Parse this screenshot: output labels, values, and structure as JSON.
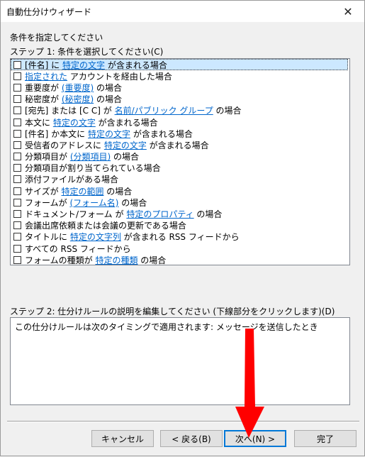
{
  "window": {
    "title": "自動仕分けウィザード",
    "close_icon": "✕"
  },
  "labels": {
    "instruction": "条件を指定してください",
    "step1": "ステップ 1: 条件を選択してください(C)",
    "step2": "ステップ 2: 仕分けルールの説明を編集してください (下線部分をクリックします)(D)"
  },
  "conditions": [
    {
      "parts": [
        {
          "t": "[件名] に "
        },
        {
          "t": "特定の文字",
          "link": true
        },
        {
          "t": " が含まれる場合"
        }
      ]
    },
    {
      "parts": [
        {
          "t": "指定された",
          "link": true
        },
        {
          "t": " アカウントを経由した場合"
        }
      ]
    },
    {
      "parts": [
        {
          "t": "重要度が "
        },
        {
          "t": "(重要度)",
          "link": true
        },
        {
          "t": " の場合"
        }
      ]
    },
    {
      "parts": [
        {
          "t": "秘密度が "
        },
        {
          "t": "(秘密度)",
          "link": true
        },
        {
          "t": " の場合"
        }
      ]
    },
    {
      "parts": [
        {
          "t": "[宛先] または [C C] が "
        },
        {
          "t": "名前/パブリック グループ",
          "link": true
        },
        {
          "t": " の場合"
        }
      ]
    },
    {
      "parts": [
        {
          "t": "本文に "
        },
        {
          "t": "特定の文字",
          "link": true
        },
        {
          "t": " が含まれる場合"
        }
      ]
    },
    {
      "parts": [
        {
          "t": "[件名] か本文に "
        },
        {
          "t": "特定の文字",
          "link": true
        },
        {
          "t": " が含まれる場合"
        }
      ]
    },
    {
      "parts": [
        {
          "t": "受信者のアドレスに "
        },
        {
          "t": "特定の文字",
          "link": true
        },
        {
          "t": " が含まれる場合"
        }
      ]
    },
    {
      "parts": [
        {
          "t": "分類項目が "
        },
        {
          "t": "(分類項目)",
          "link": true
        },
        {
          "t": " の場合"
        }
      ]
    },
    {
      "parts": [
        {
          "t": "分類項目が割り当てられている場合"
        }
      ]
    },
    {
      "parts": [
        {
          "t": "添付ファイルがある場合"
        }
      ]
    },
    {
      "parts": [
        {
          "t": "サイズが "
        },
        {
          "t": "特定の範囲",
          "link": true
        },
        {
          "t": " の場合"
        }
      ]
    },
    {
      "parts": [
        {
          "t": "フォームが "
        },
        {
          "t": "(フォーム名)",
          "link": true
        },
        {
          "t": " の場合"
        }
      ]
    },
    {
      "parts": [
        {
          "t": "ドキュメント/フォーム が "
        },
        {
          "t": "特定のプロパティ",
          "link": true
        },
        {
          "t": " の場合"
        }
      ]
    },
    {
      "parts": [
        {
          "t": "会議出席依頼または会議の更新である場合"
        }
      ]
    },
    {
      "parts": [
        {
          "t": "タイトルに "
        },
        {
          "t": "特定の文字列",
          "link": true
        },
        {
          "t": " が含まれる RSS フィードから"
        }
      ]
    },
    {
      "parts": [
        {
          "t": "すべての RSS フィードから"
        }
      ]
    },
    {
      "parts": [
        {
          "t": "フォームの種類が "
        },
        {
          "t": "特定の種類",
          "link": true
        },
        {
          "t": " の場合"
        }
      ]
    }
  ],
  "selected_index": 0,
  "description": "この仕分けルールは次のタイミングで適用されます: メッセージを送信したとき",
  "buttons": {
    "cancel": "キャンセル",
    "back": "< 戻る(B)",
    "next": "次へ(N) >",
    "finish": "完了"
  },
  "accent_color": "#ff0000"
}
